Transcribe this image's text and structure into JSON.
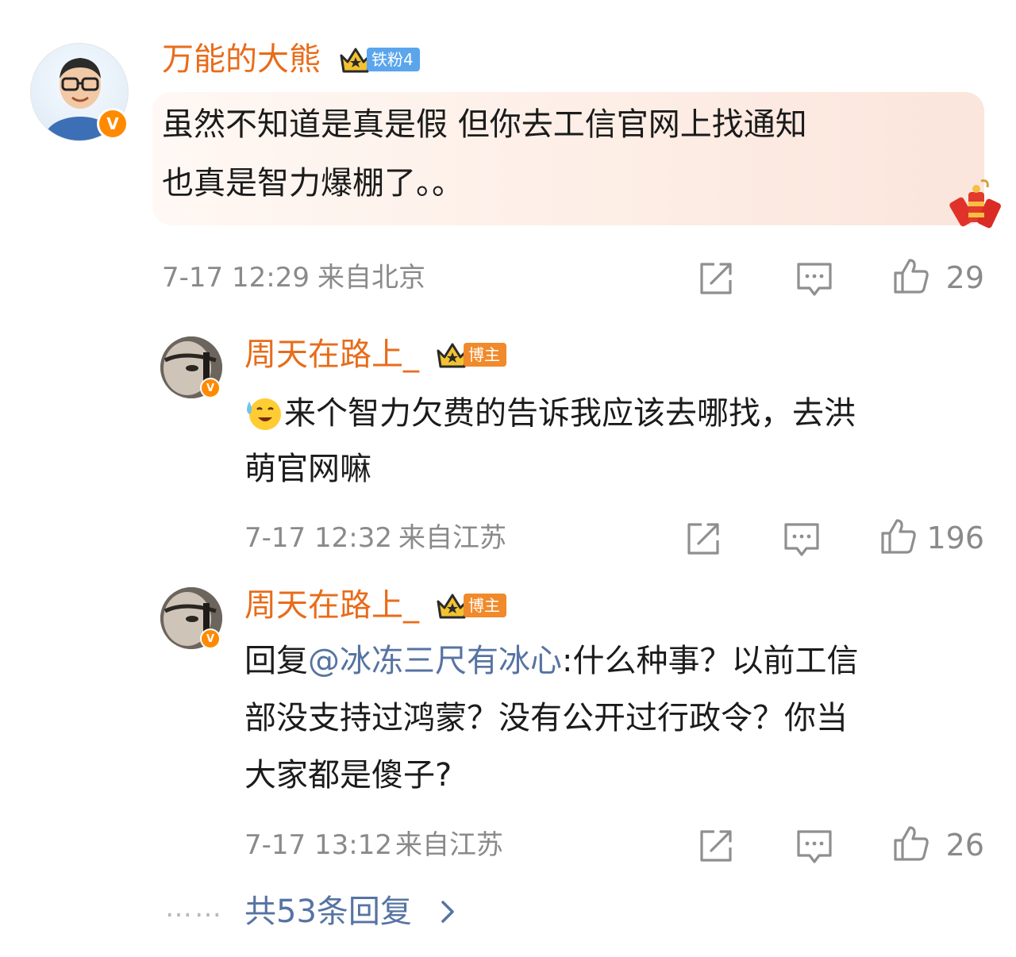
{
  "comments": [
    {
      "author": "万能的大熊",
      "badge_label": "铁粉4",
      "text_line1": "虽然不知道是真是假 但你去工信官网上找通知",
      "text_line2": "也真是智力爆棚了。。",
      "timestamp": "7-17 12:29",
      "location": "来自北京",
      "likes": "29"
    }
  ],
  "replies": [
    {
      "author": "周天在路上_",
      "badge_label": "博主",
      "text_line1": "来个智力欠费的告诉我应该去哪找，去洪",
      "text_line2": "萌官网嘛",
      "timestamp": "7-17 12:32",
      "location": "来自江苏",
      "likes": "196"
    },
    {
      "author": "周天在路上_",
      "badge_label": "博主",
      "reply_prefix": "回复",
      "mention": "@冰冻三尺有冰心",
      "text_line1_rest": ":什么种事？以前工信",
      "text_line2": "部没支持过鸿蒙？没有公开过行政令？你当",
      "text_line3": "大家都是傻子?",
      "timestamp": "7-17 13:12",
      "location": "来自江苏",
      "likes": "26"
    }
  ],
  "footer": {
    "dots": "……",
    "more_replies": "共53条回复"
  },
  "colors": {
    "username": "#e86c1a",
    "mention": "#5673a3",
    "meta_gray": "#8a8a8a",
    "verified_badge": "#ff8a00",
    "fan_badge": "#5aa5ec",
    "blogger_badge": "#f08a2a"
  },
  "icons": [
    "share-icon",
    "comment-icon",
    "like-icon",
    "chevron-right-icon",
    "crown-icon",
    "verified-v-icon",
    "firecracker-sticker",
    "emoji-sweat-smile-icon"
  ]
}
